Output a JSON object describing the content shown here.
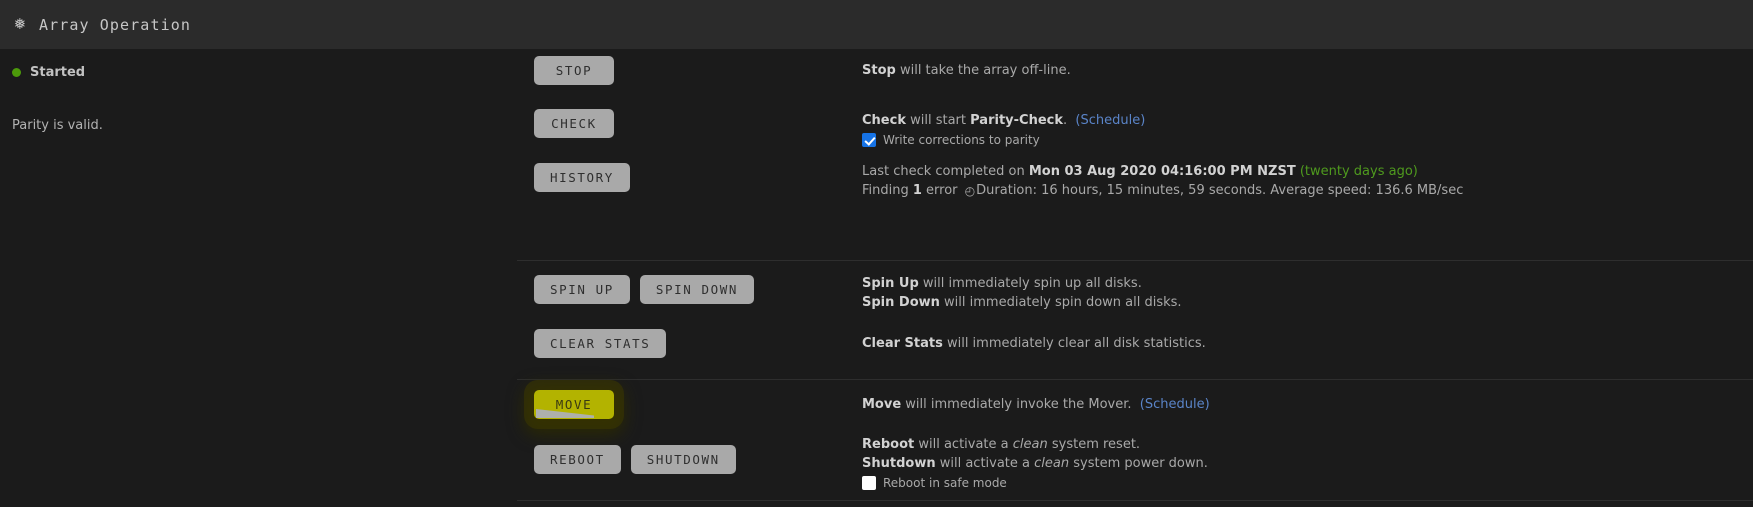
{
  "titlebar": {
    "icon": "asterisk-snowflake-icon",
    "icon_glyph": "❅",
    "title": "Array Operation"
  },
  "status": {
    "state_label": "Started",
    "state_color": "#4c9a0a",
    "parity_text": "Parity is valid."
  },
  "rows": {
    "stop": {
      "button_label": "STOP",
      "desc_bold": "Stop",
      "desc_rest": " will take the array off-line."
    },
    "check": {
      "button_label": "CHECK",
      "desc_bold": "Check",
      "desc_mid": " will start ",
      "desc_bold2": "Parity-Check",
      "desc_end": ".",
      "schedule_link": "(Schedule)",
      "checkbox_label": "Write corrections to parity",
      "checkbox_checked": true
    },
    "history": {
      "button_label": "HISTORY",
      "line1_prefix": "Last check completed on ",
      "line1_date": "Mon 03 Aug 2020 04:16:00 PM NZST",
      "line1_ago": "(twenty days ago)",
      "line2_prefix": "Finding ",
      "line2_count": "1",
      "line2_mid": " error",
      "clock_glyph": "◴",
      "line2_duration": "Duration: 16 hours, 15 minutes, 59 seconds. Average speed: 136.6 MB/sec"
    },
    "spin": {
      "spin_up_label": "SPIN UP",
      "spin_down_label": "SPIN DOWN",
      "desc1_bold": "Spin Up",
      "desc1_rest": " will immediately spin up all disks.",
      "desc2_bold": "Spin Down",
      "desc2_rest": " will immediately spin down all disks."
    },
    "clear_stats": {
      "button_label": "CLEAR STATS",
      "desc_bold": "Clear Stats",
      "desc_rest": " will immediately clear all disk statistics."
    },
    "move": {
      "button_label": "MOVE",
      "button_color": "#b3b300",
      "desc_bold": "Move",
      "desc_rest": " will immediately invoke the Mover.",
      "schedule_link": "(Schedule)"
    },
    "power": {
      "reboot_label": "REBOOT",
      "shutdown_label": "SHUTDOWN",
      "desc1_bold": "Reboot",
      "desc1_mid": " will activate a ",
      "desc1_italic": "clean",
      "desc1_end": " system reset.",
      "desc2_bold": "Shutdown",
      "desc2_mid": " will activate a ",
      "desc2_italic": "clean",
      "desc2_end": " system power down.",
      "checkbox_label": "Reboot in safe mode",
      "checkbox_checked": false
    }
  }
}
